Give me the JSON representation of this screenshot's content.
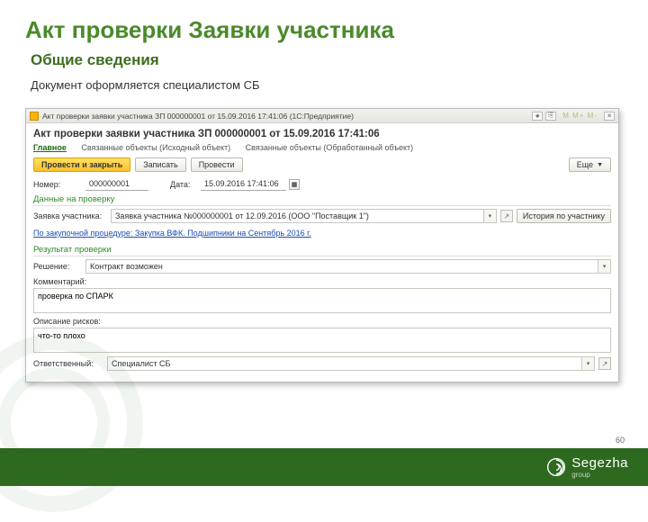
{
  "slide": {
    "title": "Акт проверки Заявки участника",
    "subtitle": "Общие сведения",
    "desc": "Документ оформляется специалистом СБ",
    "page_number": "60"
  },
  "window": {
    "title": "Акт проверки заявки участника ЗП 000000001 от 15.09.2016 17:41:06 (1С:Предприятие)",
    "mini_btns": "М М+ М-",
    "doc_title": "Акт проверки заявки участника ЗП 000000001 от 15.09.2016 17:41:06",
    "tabs": {
      "main": "Главное",
      "linked1": "Связанные объекты (Исходный объект)",
      "linked2": "Связанные объекты (Обработанный объект)"
    },
    "toolbar": {
      "post_close": "Провести и закрыть",
      "save": "Записать",
      "post": "Провести",
      "more": "Еще"
    },
    "fields": {
      "number_label": "Номер:",
      "number_value": "000000001",
      "date_label": "Дата:",
      "date_value": "15.09.2016 17:41:06"
    },
    "sections": {
      "check_data": "Данные на проверку",
      "result": "Результат проверки"
    },
    "applicant": {
      "label": "Заявка участника:",
      "value": "Заявка участника №000000001 от 12.09.2016 (ООО \"Поставщик 1\")",
      "history_btn": "История по участнику",
      "procedure_link": "По закупочной процедуре: Закупка ВФК. Подшипники на Сентябрь 2016 г."
    },
    "decision": {
      "label": "Решение:",
      "value": "Контракт возможен"
    },
    "comment": {
      "label": "Комментарий:",
      "value": "проверка по СПАРК"
    },
    "risks": {
      "label": "Описание рисков:",
      "value": "что-то плохо"
    },
    "responsible": {
      "label": "Ответственный:",
      "value": "Специалист СБ"
    }
  },
  "brand": {
    "name": "Segezha",
    "sub": "group"
  }
}
